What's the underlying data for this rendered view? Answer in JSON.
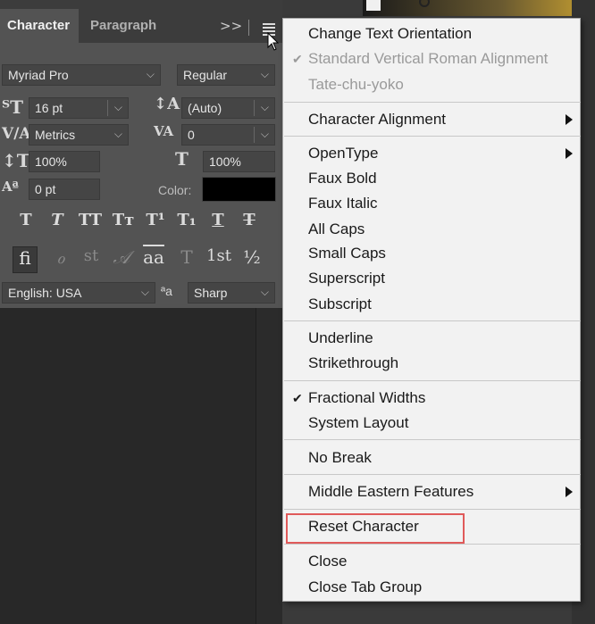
{
  "tabs": {
    "character": "Character",
    "paragraph": "Paragraph"
  },
  "panel_menu": {
    "expand_label": ">>"
  },
  "font": {
    "family": "Myriad Pro",
    "style": "Regular"
  },
  "size": {
    "font_size": "16 pt",
    "leading": "(Auto)"
  },
  "kerning": {
    "kerning": "Metrics",
    "tracking": "0"
  },
  "scale": {
    "vertical": "100%",
    "horizontal": "100%"
  },
  "baseline": {
    "shift": "0 pt",
    "color_label": "Color:",
    "color": "#000000"
  },
  "type_buttons": [
    "T",
    "T",
    "TT",
    "Tт",
    "T¹",
    "T₁",
    "T",
    "T"
  ],
  "opentype_buttons": [
    "ﬁ",
    "ℴ",
    "st",
    "𝒜",
    "aa",
    "T",
    "1st",
    "½"
  ],
  "language": {
    "value": "English: USA",
    "aa_label": "ªa",
    "antialias": "Sharp"
  },
  "menu": {
    "change_text_orientation": "Change Text Orientation",
    "standard_vertical": "Standard Vertical Roman Alignment",
    "tate_chu_yoko": "Tate-chu-yoko",
    "character_alignment": "Character Alignment",
    "opentype": "OpenType",
    "faux_bold": "Faux Bold",
    "faux_italic": "Faux Italic",
    "all_caps": "All Caps",
    "small_caps": "Small Caps",
    "superscript": "Superscript",
    "subscript": "Subscript",
    "underline": "Underline",
    "strikethrough": "Strikethrough",
    "fractional_widths": "Fractional Widths",
    "system_layout": "System Layout",
    "no_break": "No Break",
    "middle_eastern": "Middle Eastern Features",
    "reset_character": "Reset Character",
    "close": "Close",
    "close_tab_group": "Close Tab Group"
  },
  "colors": {
    "highlight": "#e05a5a",
    "panel": "#535353",
    "menu_bg": "#f2f2f2"
  }
}
